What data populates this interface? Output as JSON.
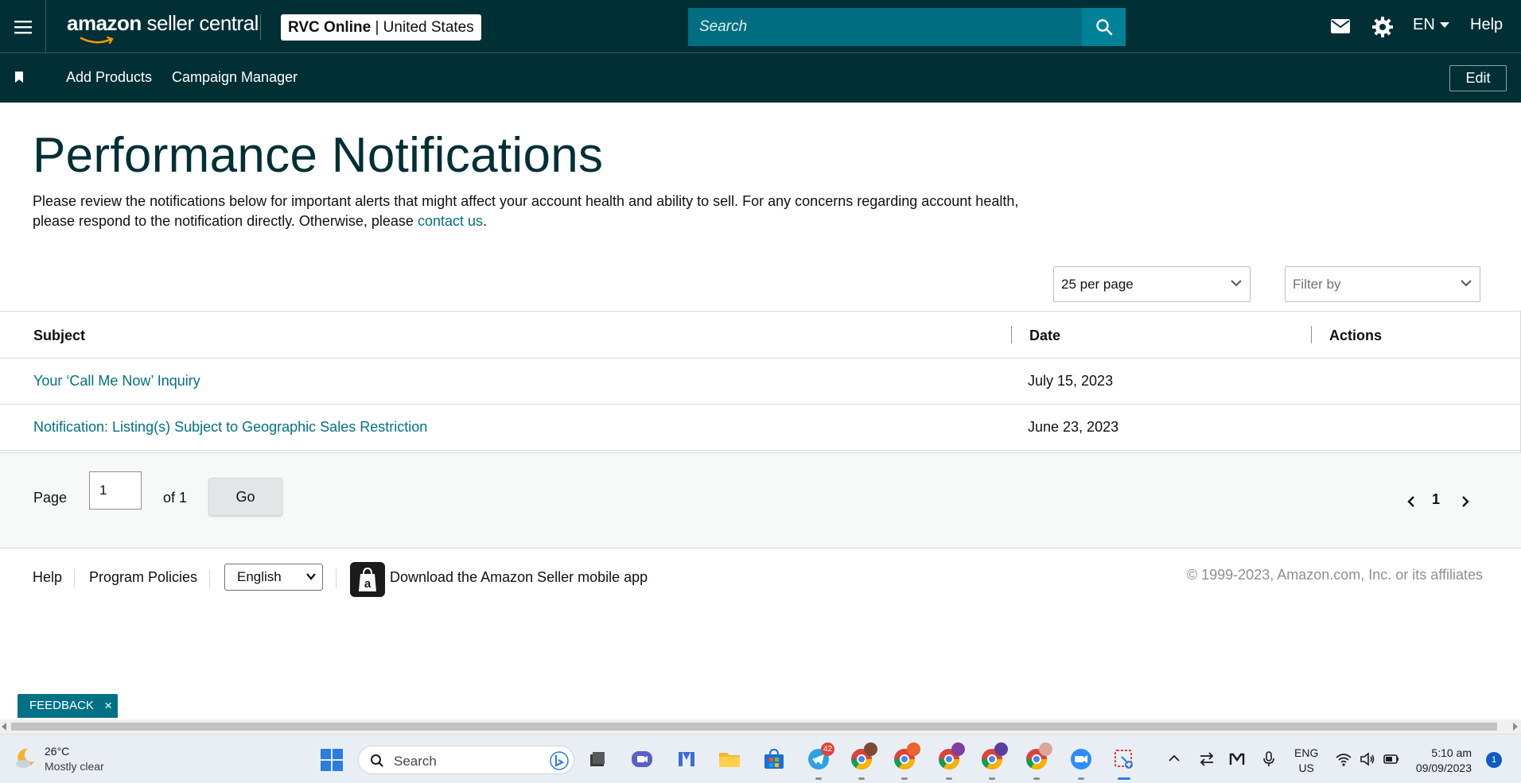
{
  "header": {
    "logo_text_bold": "amazon",
    "logo_text_rest": " seller central",
    "account_name": "RVC Online",
    "account_sep": " | ",
    "account_region": "United States",
    "search_placeholder": "Search",
    "language": "EN",
    "help_label": "Help"
  },
  "subnav": {
    "items": [
      {
        "label": "Add Products"
      },
      {
        "label": "Campaign Manager"
      }
    ],
    "edit_label": "Edit"
  },
  "main": {
    "title": "Performance Notifications",
    "intro_text": "Please review the notifications below for important alerts that might affect your account health and ability to sell. For any concerns regarding account health, please respond to the notification directly. Otherwise, please ",
    "intro_link": "contact us",
    "intro_end": ".",
    "per_page_value": "25 per page",
    "filter_placeholder": "Filter by"
  },
  "table": {
    "columns": [
      "Subject",
      "Date",
      "Actions"
    ],
    "rows": [
      {
        "subject": "Your ‘Call Me Now’ Inquiry",
        "date": "July 15, 2023"
      },
      {
        "subject": "Notification: Listing(s) Subject to Geographic Sales Restriction",
        "date": "June 23, 2023"
      }
    ]
  },
  "pagination": {
    "page_label": "Page",
    "page_value": "1",
    "of_label": "of 1",
    "go_label": "Go",
    "current_page": "1"
  },
  "footer": {
    "help_label": "Help",
    "policies_label": "Program Policies",
    "language_value": "English",
    "app_label": "Download the Amazon Seller mobile app",
    "copyright": "© 1999-2023, Amazon.com, Inc. or its affiliates"
  },
  "feedback": {
    "label": "FEEDBACK",
    "close": "×"
  },
  "taskbar": {
    "temperature": "26°C",
    "weather": "Mostly clear",
    "search_label": "Search",
    "telegram_badge": "42",
    "lang_line1": "ENG",
    "lang_line2": "US",
    "time": "5:10 am",
    "date": "09/09/2023",
    "notifications": "1",
    "icons": [
      "windows-start-icon",
      "file-explorer-icon",
      "video-meet-icon",
      "app-m-icon",
      "folder-icon",
      "store-icon",
      "telegram-icon",
      "chrome-icon",
      "zoom-icon",
      "snipping-tool-icon"
    ]
  },
  "colors": {
    "header_bg": "#002f36",
    "link": "#007185",
    "search_bg": "#006e80"
  }
}
